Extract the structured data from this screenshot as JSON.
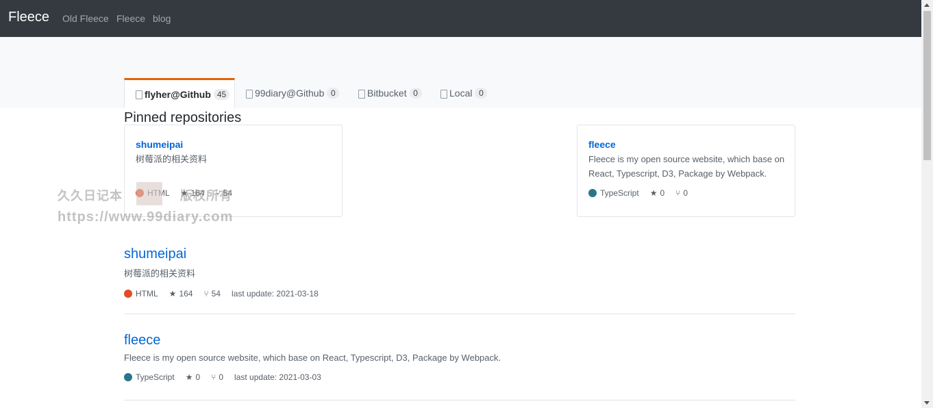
{
  "navbar": {
    "brand": "Fleece",
    "links": [
      "Old Fleece",
      "Fleece",
      "blog"
    ]
  },
  "tabs": [
    {
      "label": "flyher@Github",
      "count": "45"
    },
    {
      "label": "99diary@Github",
      "count": "0"
    },
    {
      "label": "Bitbucket",
      "count": "0"
    },
    {
      "label": "Local",
      "count": "0"
    }
  ],
  "pinned": {
    "title": "Pinned repositories",
    "cards": [
      {
        "name": "shumeipai",
        "description": "树莓派的相关资料",
        "language": "HTML",
        "language_color": "#e34c26",
        "stars": "164",
        "forks": "54"
      },
      {
        "name": "fleece",
        "description": "Fleece is my open source website, which base on React, Typescript, D3, Package by Webpack.",
        "language": "TypeScript",
        "language_color": "#2b7489",
        "stars": "0",
        "forks": "0"
      }
    ]
  },
  "repos": [
    {
      "name": "shumeipai",
      "description": "树莓派的相关资料",
      "language": "HTML",
      "language_color": "#e34c26",
      "stars": "164",
      "forks": "54",
      "last_update": "last update: 2021-03-18"
    },
    {
      "name": "fleece",
      "description": "Fleece is my open source website, which base on React, Typescript, D3, Package by Webpack.",
      "language": "TypeScript",
      "language_color": "#2b7489",
      "stars": "0",
      "forks": "0",
      "last_update": "last update: 2021-03-03"
    }
  ],
  "watermark": {
    "line1": "久久日记本",
    "line1b": "版权所有",
    "line2": "https://www.99diary.com"
  },
  "colors": {
    "navbar": "#343a40",
    "link": "#0366d6",
    "tab_accent": "#e36209"
  },
  "icons": {
    "tab": "repo-book-icon",
    "star": "star-icon",
    "fork": "fork-icon"
  }
}
